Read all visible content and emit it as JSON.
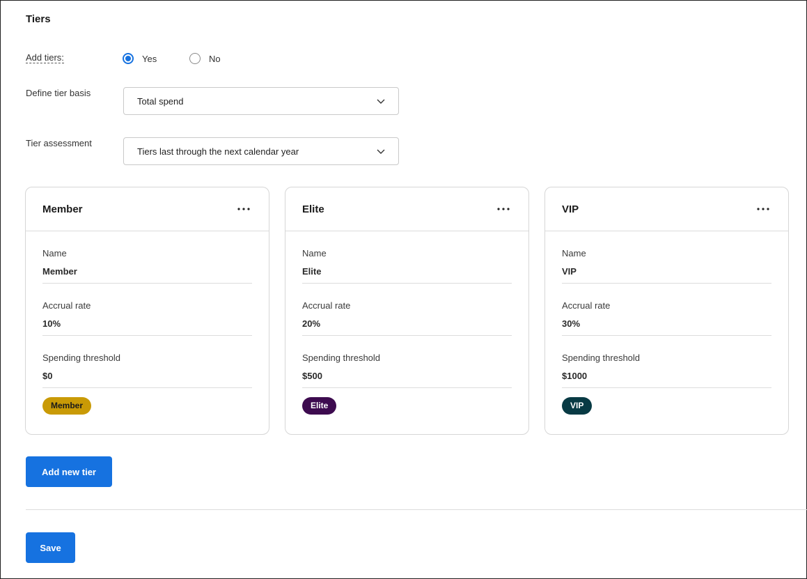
{
  "section": {
    "title": "Tiers"
  },
  "add_tiers": {
    "label": "Add tiers:",
    "options": [
      {
        "label": "Yes",
        "selected": true
      },
      {
        "label": "No",
        "selected": false
      }
    ]
  },
  "tier_basis": {
    "label": "Define tier basis",
    "value": "Total spend"
  },
  "tier_assessment": {
    "label": "Tier assessment",
    "value": "Tiers last through the next calendar year"
  },
  "field_labels": {
    "name": "Name",
    "accrual": "Accrual rate",
    "threshold": "Spending threshold"
  },
  "tiers": [
    {
      "title": "Member",
      "name": "Member",
      "accrual_rate": "10%",
      "spending_threshold": "$0",
      "badge": "Member",
      "badge_bg": "#c99a06",
      "badge_fg": "#1a1a1a"
    },
    {
      "title": "Elite",
      "name": "Elite",
      "accrual_rate": "20%",
      "spending_threshold": "$500",
      "badge": "Elite",
      "badge_bg": "#3d0b4f",
      "badge_fg": "#ffffff"
    },
    {
      "title": "VIP",
      "name": "VIP",
      "accrual_rate": "30%",
      "spending_threshold": "$1000",
      "badge": "VIP",
      "badge_bg": "#083a44",
      "badge_fg": "#ffffff"
    }
  ],
  "buttons": {
    "add_tier": "Add new tier",
    "save": "Save"
  },
  "icons": {
    "select": "chevron-down-icon",
    "card_menu": "more-horizontal-icon"
  },
  "colors": {
    "accent": "#1672e0"
  }
}
